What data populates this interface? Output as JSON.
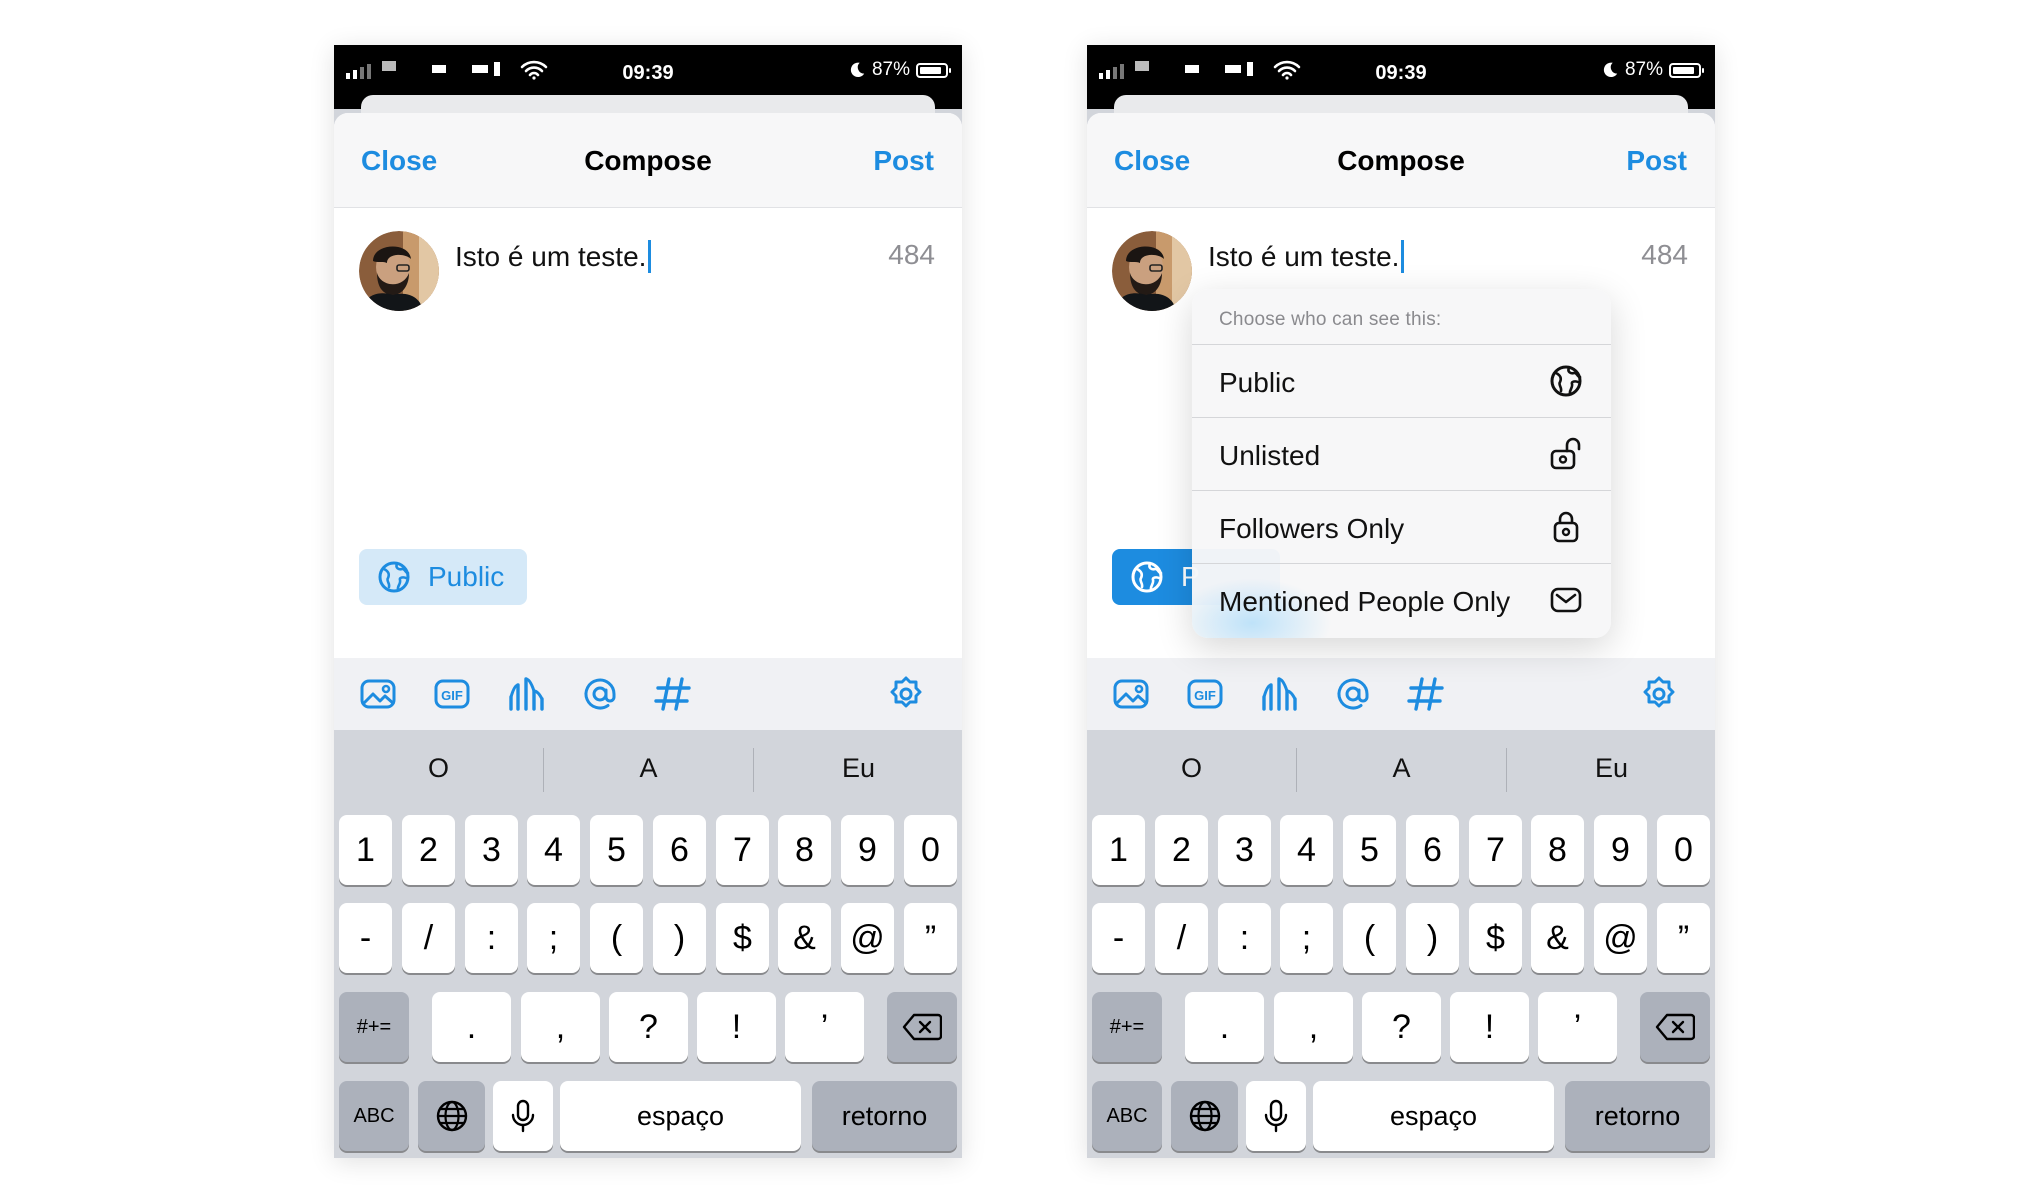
{
  "status": {
    "time": "09:39",
    "battery": "87%",
    "battery_level": 0.87
  },
  "nav": {
    "close": "Close",
    "title": "Compose",
    "post": "Post"
  },
  "compose": {
    "text": "Isto é um teste.",
    "char_count": "484"
  },
  "visibility": {
    "label": "Public",
    "label_truncated": "P"
  },
  "toolbar": {
    "icons": [
      "image-icon",
      "gif-icon",
      "poll-icon",
      "mention-icon",
      "hashtag-icon",
      "settings-icon"
    ]
  },
  "keyboard": {
    "suggestions": [
      "O",
      "A",
      "Eu"
    ],
    "row1": [
      "1",
      "2",
      "3",
      "4",
      "5",
      "6",
      "7",
      "8",
      "9",
      "0"
    ],
    "row2": [
      "-",
      "/",
      ":",
      ";",
      "(",
      ")",
      "$",
      "&",
      "@",
      "”"
    ],
    "row3": {
      "symbols": "#+=",
      "keys": [
        ".",
        ",",
        "?",
        "!",
        "’"
      ],
      "delete": "backspace-icon"
    },
    "row4": {
      "abc": "ABC",
      "globe": "globe-icon",
      "mic": "microphone-icon",
      "space": "espaço",
      "return": "retorno"
    }
  },
  "visibility_menu": {
    "header": "Choose who can see this:",
    "options": [
      {
        "label": "Public",
        "icon": "globe-icon"
      },
      {
        "label": "Unlisted",
        "icon": "unlock-icon"
      },
      {
        "label": "Followers Only",
        "icon": "lock-icon"
      },
      {
        "label": "Mentioned People Only",
        "icon": "envelope-icon"
      }
    ]
  },
  "colors": {
    "accent": "#1d8ce0",
    "accent_soft": "#d5e9f8",
    "keyboard_bg": "#d2d5db",
    "dark_key": "#acb1bb"
  }
}
